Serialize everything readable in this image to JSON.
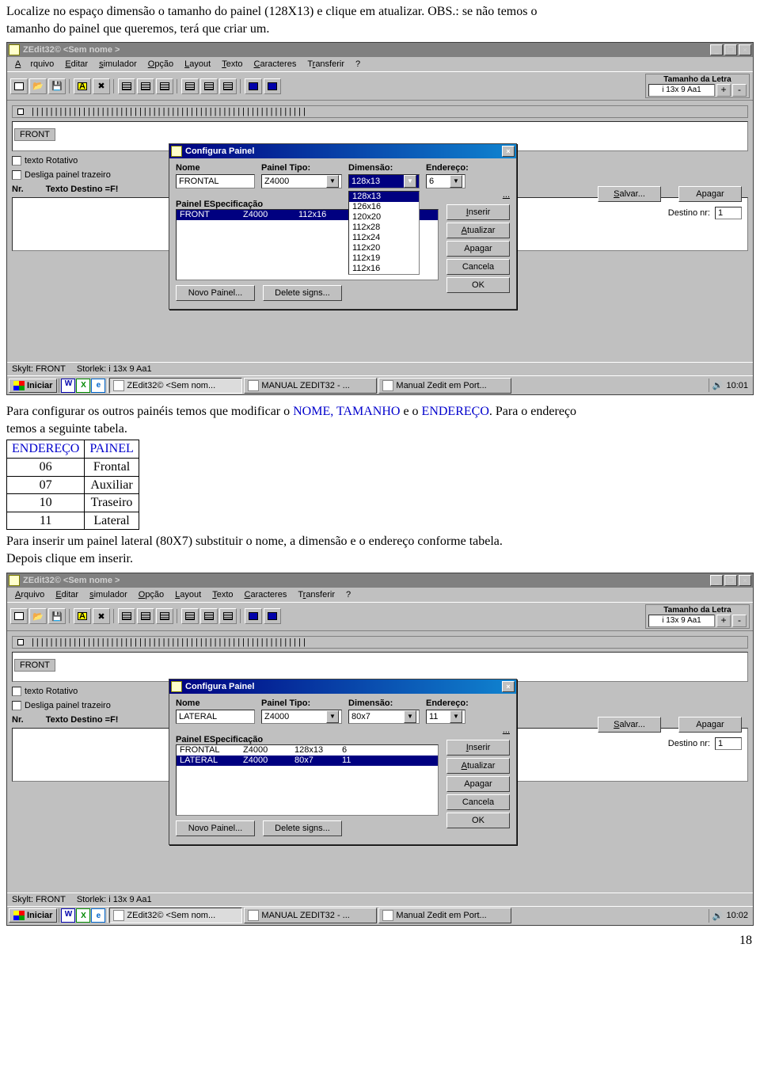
{
  "intro": {
    "line1": "Localize no espaço dimensão o tamanho do painel (128X13) e clique em atualizar. OBS.: se não temos o",
    "line2": "tamanho do painel que queremos, terá que criar um."
  },
  "app": {
    "title": "ZEdit32© <Sem nome >",
    "menu": {
      "arquivo": "Arquivo",
      "editar": "Editar",
      "simulador": "simulador",
      "opcao": "Opção",
      "layout": "Layout",
      "texto": "Texto",
      "caracteres": "Caracteres",
      "transferir": "Transferir",
      "help": "?"
    },
    "tamanho_label": "Tamanho da Letra",
    "tamanho_value": "i 13x 9 Aa1",
    "ruler_front": "FRONT",
    "destino_label": "Destino nr:",
    "destino_value": "1",
    "btn_salvar": "Salvar...",
    "btn_apagar": "Apagar",
    "chk_rotativo": "texto Rotativo",
    "chk_desliga": "Desliga painel trazeiro",
    "row_nr": "Nr.",
    "row_texto": "Texto Destino =F!",
    "status_skylt": "Skylt:  FRONT",
    "status_storlek": "Storlek: i 13x 9 Aa1"
  },
  "dialog1": {
    "title": "Configura Painel",
    "lbl_nome": "Nome",
    "lbl_tipo": "Painel Tipo:",
    "lbl_dim": "Dimensão:",
    "lbl_end": "Endereço:",
    "val_nome": "FRONTAL",
    "val_tipo": "Z4000",
    "val_dim": "128x13",
    "val_end": "6",
    "dots": "...",
    "espec_label": "Painel ESpecificação",
    "espec_rows": [
      [
        "FRONT",
        "Z4000",
        "112x16"
      ]
    ],
    "dim_options": [
      "128x13",
      "126x16",
      "120x20",
      "112x28",
      "112x24",
      "112x20",
      "112x19",
      "112x16"
    ],
    "btn_inserir": "Inserir",
    "btn_atualizar": "Atualizar",
    "btn_apagar": "Apagar",
    "btn_cancela": "Cancela",
    "btn_ok": "OK",
    "btn_novo": "Novo Painel...",
    "btn_delete": "Delete signs..."
  },
  "taskbar1": {
    "start": "Iniciar",
    "tasks": [
      "ZEdit32© <Sem nom...",
      "MANUAL ZEDIT32 - ...",
      "Manual Zedit em Port..."
    ],
    "time": "10:01"
  },
  "middle": {
    "p1a": "Para configurar os outros painéis temos que modificar o ",
    "p1b": "NOME, TAMANHO",
    "p1c": " e o ",
    "p1d": "ENDEREÇO",
    "p1e": ". Para o endereço",
    "p2": "temos a seguinte tabela.",
    "table_headers": [
      "ENDEREÇO",
      "PAINEL"
    ],
    "table_rows": [
      [
        "06",
        "Frontal"
      ],
      [
        "07",
        "Auxiliar"
      ],
      [
        "10",
        "Traseiro"
      ],
      [
        "11",
        "Lateral"
      ]
    ],
    "p3": "Para inserir um painel lateral (80X7) substituir o nome, a dimensão e o endereço conforme tabela.",
    "p4": "Depois clique em inserir."
  },
  "dialog2": {
    "title": "Configura Painel",
    "val_nome": "LATERAL",
    "val_tipo": "Z4000",
    "val_dim": "80x7",
    "val_end": "11",
    "espec_rows": [
      [
        "FRONTAL",
        "Z4000",
        "128x13",
        "6"
      ],
      [
        "LATERAL",
        "Z4000",
        "80x7",
        "11"
      ]
    ]
  },
  "taskbar2": {
    "time": "10:02"
  },
  "page_number": "18"
}
